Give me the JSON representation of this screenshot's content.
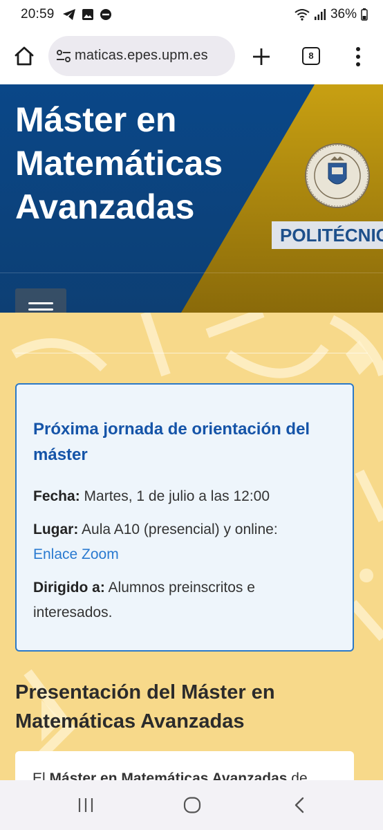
{
  "status_bar": {
    "time": "20:59",
    "battery": "36%",
    "icons": [
      "telegram-icon",
      "gallery-icon",
      "do-not-disturb-icon",
      "wifi-icon",
      "signal-icon",
      "battery-icon"
    ]
  },
  "browser": {
    "url": "maticas.epes.upm.es",
    "tab_count": "8",
    "icons": [
      "home-icon",
      "site-settings-icon",
      "plus-icon",
      "tabs-icon",
      "more-vert-icon"
    ]
  },
  "header": {
    "title_lines": [
      "Máster en",
      "Matemáticas",
      "Avanzadas"
    ],
    "badge": "POLITÉCNIC",
    "colors": {
      "blue": "#0c4a86",
      "gold": "#c49a0e"
    }
  },
  "event_card": {
    "title": "Próxima jornada de orientación del máster",
    "date_label": "Fecha:",
    "date_value": " Martes, 1 de julio a las 12:00",
    "place_label": "Lugar:",
    "place_value": " Aula A10 (presencial) y online:",
    "place_link": "Enlace Zoom",
    "audience_label": "Dirigido a:",
    "audience_value": " Alumnos preinscritos e interesados."
  },
  "presentation": {
    "title": "Presentación del Máster en Matemáticas Avanzadas",
    "text_start": "El ",
    "text_bold": "Máster en Matemáticas Avanzadas",
    "text_end": " de"
  },
  "nav_bar": {
    "icons": [
      "recents-icon",
      "home-circle-icon",
      "back-icon"
    ]
  }
}
